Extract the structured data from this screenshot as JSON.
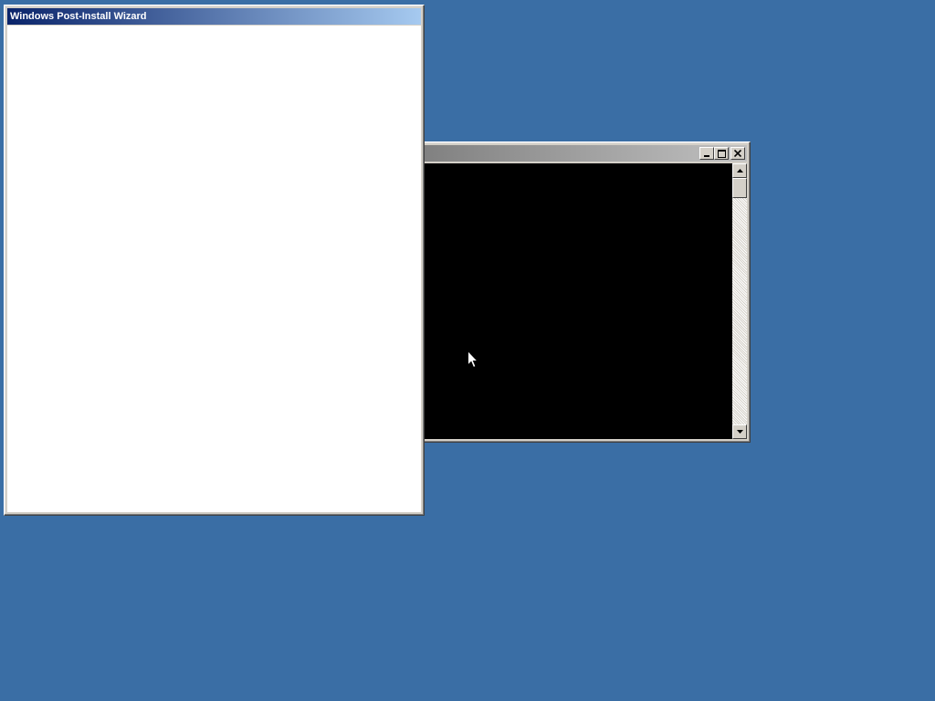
{
  "desktop": {
    "background_color": "#3a6ea5"
  },
  "wizard_window": {
    "title": "Windows Post-Install Wizard",
    "titlebar_gradient": [
      "#0a246a",
      "#a6caf0"
    ],
    "state": "active"
  },
  "console_window": {
    "title": "",
    "state": "inactive",
    "buttons": {
      "minimize_icon": "minimize-icon",
      "maximize_icon": "maximize-icon",
      "close_icon": "close-icon"
    },
    "scrollbar": {
      "up_icon": "arrow-up-icon",
      "down_icon": "arrow-down-icon"
    }
  },
  "cursor": {
    "icon": "arrow-pointer-icon"
  }
}
